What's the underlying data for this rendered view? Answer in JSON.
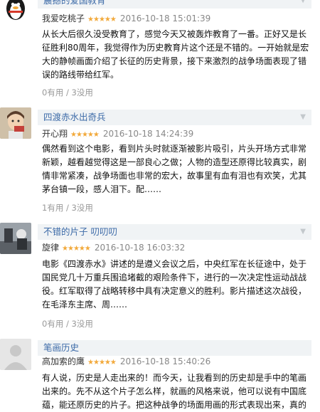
{
  "reviews": [
    {
      "title": "震撼的爱国教育",
      "user": "我爱吃桃子",
      "stars": "★★★★★",
      "date": "2016-10-18 15:01:39",
      "content": "从长大后很久没受教育了，感觉今天又被轰炸教育了一番。正好又是长征胜利80周年，我觉得作为历史教育片这个还是不错的。一开始就是宏大的静帧画面介绍了长征的历史背景，接下来激烈的战争场面表现了错误的路线带给红军。",
      "useful": "0有用",
      "useless": "3没用"
    },
    {
      "title": "四渡赤水出奇兵",
      "user": "开心翔",
      "stars": "★★★★★",
      "date": "2016-10-18 14:24:39",
      "content": "偶然看到这个电影，看到片头时就逐渐被影片吸引，片头开场方式非常新颖，越看越觉得这是一部良心之做；人物的造型还原得比较真实，剧情非常紧凑，战争场面也非常的宏大，故事里有血有泪也有欢笑，尤其茅台镇一段，感人泪下。配……",
      "useful": "1有用",
      "useless": "3没用"
    },
    {
      "title": "不错的片子 叨叨叨",
      "user": "旋律",
      "stars": "★★★★★",
      "date": "2016-10-18 16:03:32",
      "content": "电影《四渡赤水》讲述的是遵义会议之后，中央红军在长征途中，处于国民党几十万重兵围追堵截的艰险条件下，进行的一次决定性运动战战役。红军取得了战略转移中具有决定意义的胜利。影片描述这次战役，在毛泽东主席、周……",
      "useful": "0有用",
      "useless": "3没用"
    },
    {
      "title": "笔画历史",
      "user": "高加索的鹰",
      "stars": "★★★★★",
      "date": "2016-10-18 15:40:26",
      "content": "有人说，历史是人走出来的！而今天，让我看到的历史却是手中的笔画出来的。先不从这个片子怎么样，就画的风格来说，他可以说有中国底蕴，能还原历史的片子。把这种战争的场面用画的形式表现出来，真的",
      "useful": "",
      "useless": ""
    }
  ],
  "colors": {
    "title_bg": "#f0f3f5",
    "title_text": "#3d6ba8",
    "stars": "#f2a93b",
    "muted": "#999999"
  }
}
